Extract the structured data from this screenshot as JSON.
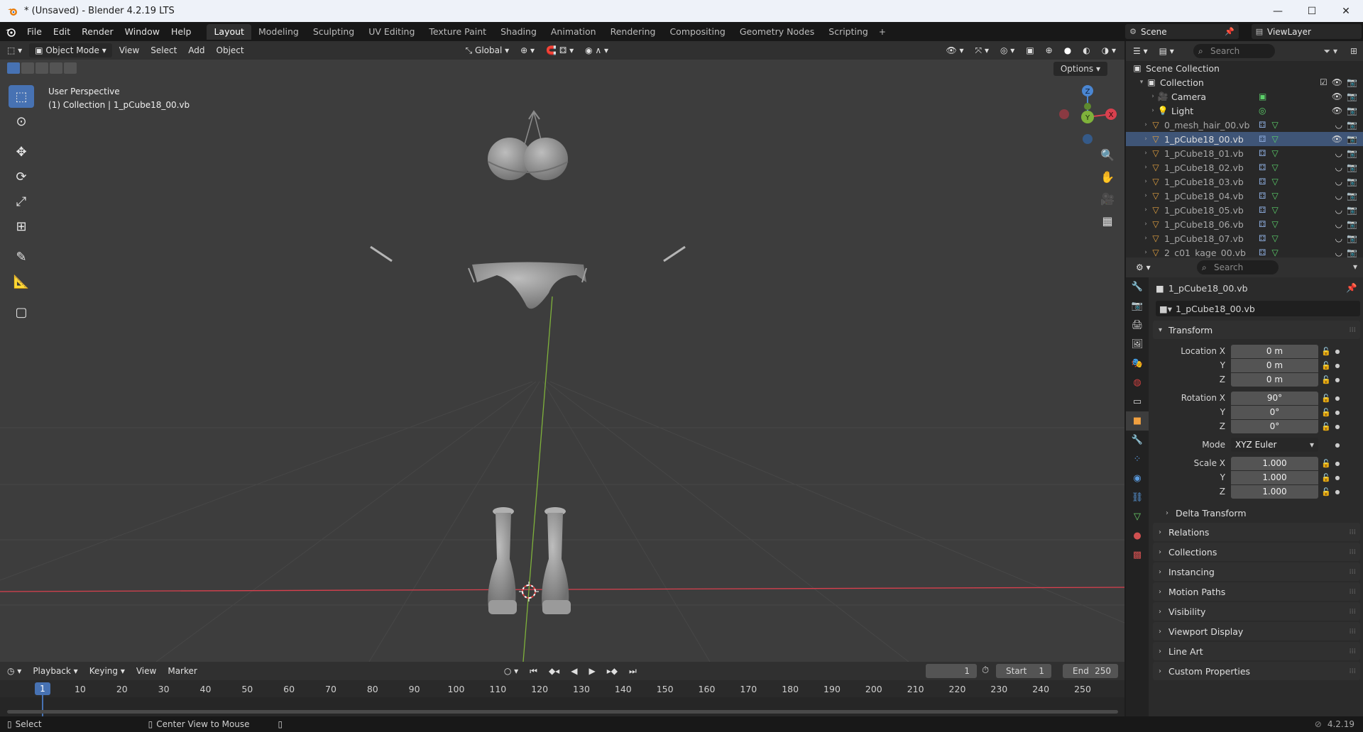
{
  "window": {
    "title": "* (Unsaved) - Blender 4.2.19 LTS",
    "buttons": [
      "—",
      "☐",
      "✕"
    ]
  },
  "menu": [
    "File",
    "Edit",
    "Render",
    "Window",
    "Help"
  ],
  "workspaces": [
    "Layout",
    "Modeling",
    "Sculpting",
    "UV Editing",
    "Texture Paint",
    "Shading",
    "Animation",
    "Rendering",
    "Compositing",
    "Geometry Nodes",
    "Scripting"
  ],
  "active_workspace": "Layout",
  "scene": "Scene",
  "view_layer": "ViewLayer",
  "viewport": {
    "mode": "Object Mode",
    "menus": [
      "View",
      "Select",
      "Add",
      "Object"
    ],
    "orientation": "Global",
    "options": "Options",
    "perspective": "User Perspective",
    "context": "(1) Collection | 1_pCube18_00.vb",
    "gizmo_axes": [
      "Z",
      "X",
      "Y"
    ]
  },
  "timeline": {
    "menus": [
      "Playback",
      "Keying",
      "View",
      "Marker"
    ],
    "current_frame": "1",
    "start_label": "Start",
    "start": "1",
    "end_label": "End",
    "end": "250",
    "ruler": [
      "1",
      "10",
      "20",
      "30",
      "40",
      "50",
      "60",
      "70",
      "80",
      "90",
      "100",
      "110",
      "120",
      "130",
      "140",
      "150",
      "160",
      "170",
      "180",
      "190",
      "200",
      "210",
      "220",
      "230",
      "240",
      "250"
    ]
  },
  "status": {
    "select": "Select",
    "center_view": "Center View to Mouse",
    "version": "4.2.19"
  },
  "outliner": {
    "search_placeholder": "Search",
    "scene_collection": "Scene Collection",
    "collection": "Collection",
    "items": [
      {
        "name": "Camera",
        "type": "camera"
      },
      {
        "name": "Light",
        "type": "light"
      },
      {
        "name": "0_mesh_hair_00.vb",
        "type": "mesh"
      },
      {
        "name": "1_pCube18_00.vb",
        "type": "mesh",
        "selected": true
      },
      {
        "name": "1_pCube18_01.vb",
        "type": "mesh"
      },
      {
        "name": "1_pCube18_02.vb",
        "type": "mesh"
      },
      {
        "name": "1_pCube18_03.vb",
        "type": "mesh"
      },
      {
        "name": "1_pCube18_04.vb",
        "type": "mesh"
      },
      {
        "name": "1_pCube18_05.vb",
        "type": "mesh"
      },
      {
        "name": "1_pCube18_06.vb",
        "type": "mesh"
      },
      {
        "name": "1_pCube18_07.vb",
        "type": "mesh"
      },
      {
        "name": "2_c01_kage_00.vb",
        "type": "mesh"
      }
    ]
  },
  "properties": {
    "search_placeholder": "Search",
    "object_name": "1_pCube18_00.vb",
    "object_field": "1_pCube18_00.vb",
    "transform_title": "Transform",
    "location_label": "Location X",
    "rotation_label": "Rotation X",
    "scale_label": "Scale X",
    "y_label": "Y",
    "z_label": "Z",
    "location": [
      "0 m",
      "0 m",
      "0 m"
    ],
    "rotation": [
      "90°",
      "0°",
      "0°"
    ],
    "mode_label": "Mode",
    "mode_value": "XYZ Euler",
    "scale": [
      "1.000",
      "1.000",
      "1.000"
    ],
    "delta_transform": "Delta Transform",
    "panels": [
      "Relations",
      "Collections",
      "Instancing",
      "Motion Paths",
      "Visibility",
      "Viewport Display",
      "Line Art",
      "Custom Properties"
    ]
  },
  "colors": {
    "accent": "#4772b3",
    "x_axis": "#d9404e",
    "y_axis": "#7fb23b",
    "z_axis": "#4a86d2"
  }
}
